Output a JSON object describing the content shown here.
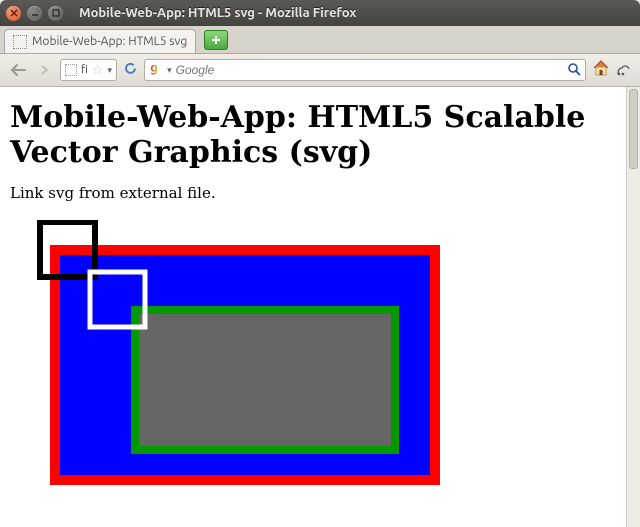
{
  "window": {
    "title": "Mobile-Web-App: HTML5 svg - Mozilla Firefox"
  },
  "tab": {
    "label": "Mobile-Web-App: HTML5 svg"
  },
  "toolbar": {
    "url_scheme": "fi",
    "search_placeholder": "Google"
  },
  "page": {
    "heading": "Mobile-Web-App: HTML5 Scalable Vector Graphics (svg)",
    "paragraph": "Link svg from external file."
  }
}
